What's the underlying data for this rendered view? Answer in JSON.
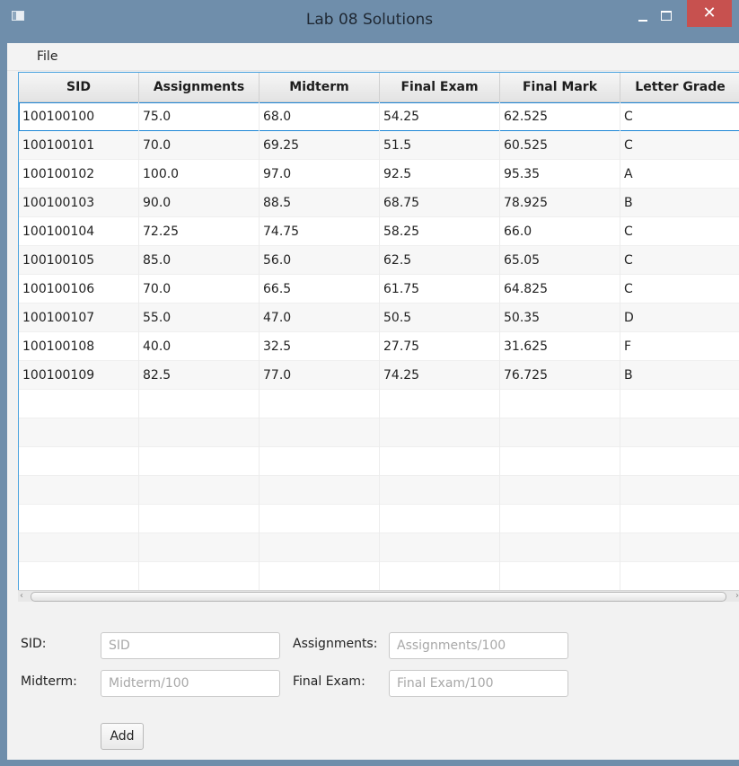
{
  "window": {
    "title": "Lab 08 Solutions"
  },
  "menu": {
    "file": "File"
  },
  "table": {
    "headers": [
      "SID",
      "Assignments",
      "Midterm",
      "Final Exam",
      "Final Mark",
      "Letter Grade"
    ],
    "rows": [
      [
        "100100100",
        "75.0",
        "68.0",
        "54.25",
        "62.525",
        "C"
      ],
      [
        "100100101",
        "70.0",
        "69.25",
        "51.5",
        "60.525",
        "C"
      ],
      [
        "100100102",
        "100.0",
        "97.0",
        "92.5",
        "95.35",
        "A"
      ],
      [
        "100100103",
        "90.0",
        "88.5",
        "68.75",
        "78.925",
        "B"
      ],
      [
        "100100104",
        "72.25",
        "74.75",
        "58.25",
        "66.0",
        "C"
      ],
      [
        "100100105",
        "85.0",
        "56.0",
        "62.5",
        "65.05",
        "C"
      ],
      [
        "100100106",
        "70.0",
        "66.5",
        "61.75",
        "64.825",
        "C"
      ],
      [
        "100100107",
        "55.0",
        "47.0",
        "50.5",
        "50.35",
        "D"
      ],
      [
        "100100108",
        "40.0",
        "32.5",
        "27.75",
        "31.625",
        "F"
      ],
      [
        "100100109",
        "82.5",
        "77.0",
        "74.25",
        "76.725",
        "B"
      ]
    ]
  },
  "form": {
    "sid_label": "SID:",
    "sid_placeholder": "SID",
    "assignments_label": "Assignments:",
    "assignments_placeholder": "Assignments/100",
    "midterm_label": "Midterm:",
    "midterm_placeholder": "Midterm/100",
    "final_exam_label": "Final Exam:",
    "final_exam_placeholder": "Final Exam/100",
    "add_label": "Add"
  }
}
